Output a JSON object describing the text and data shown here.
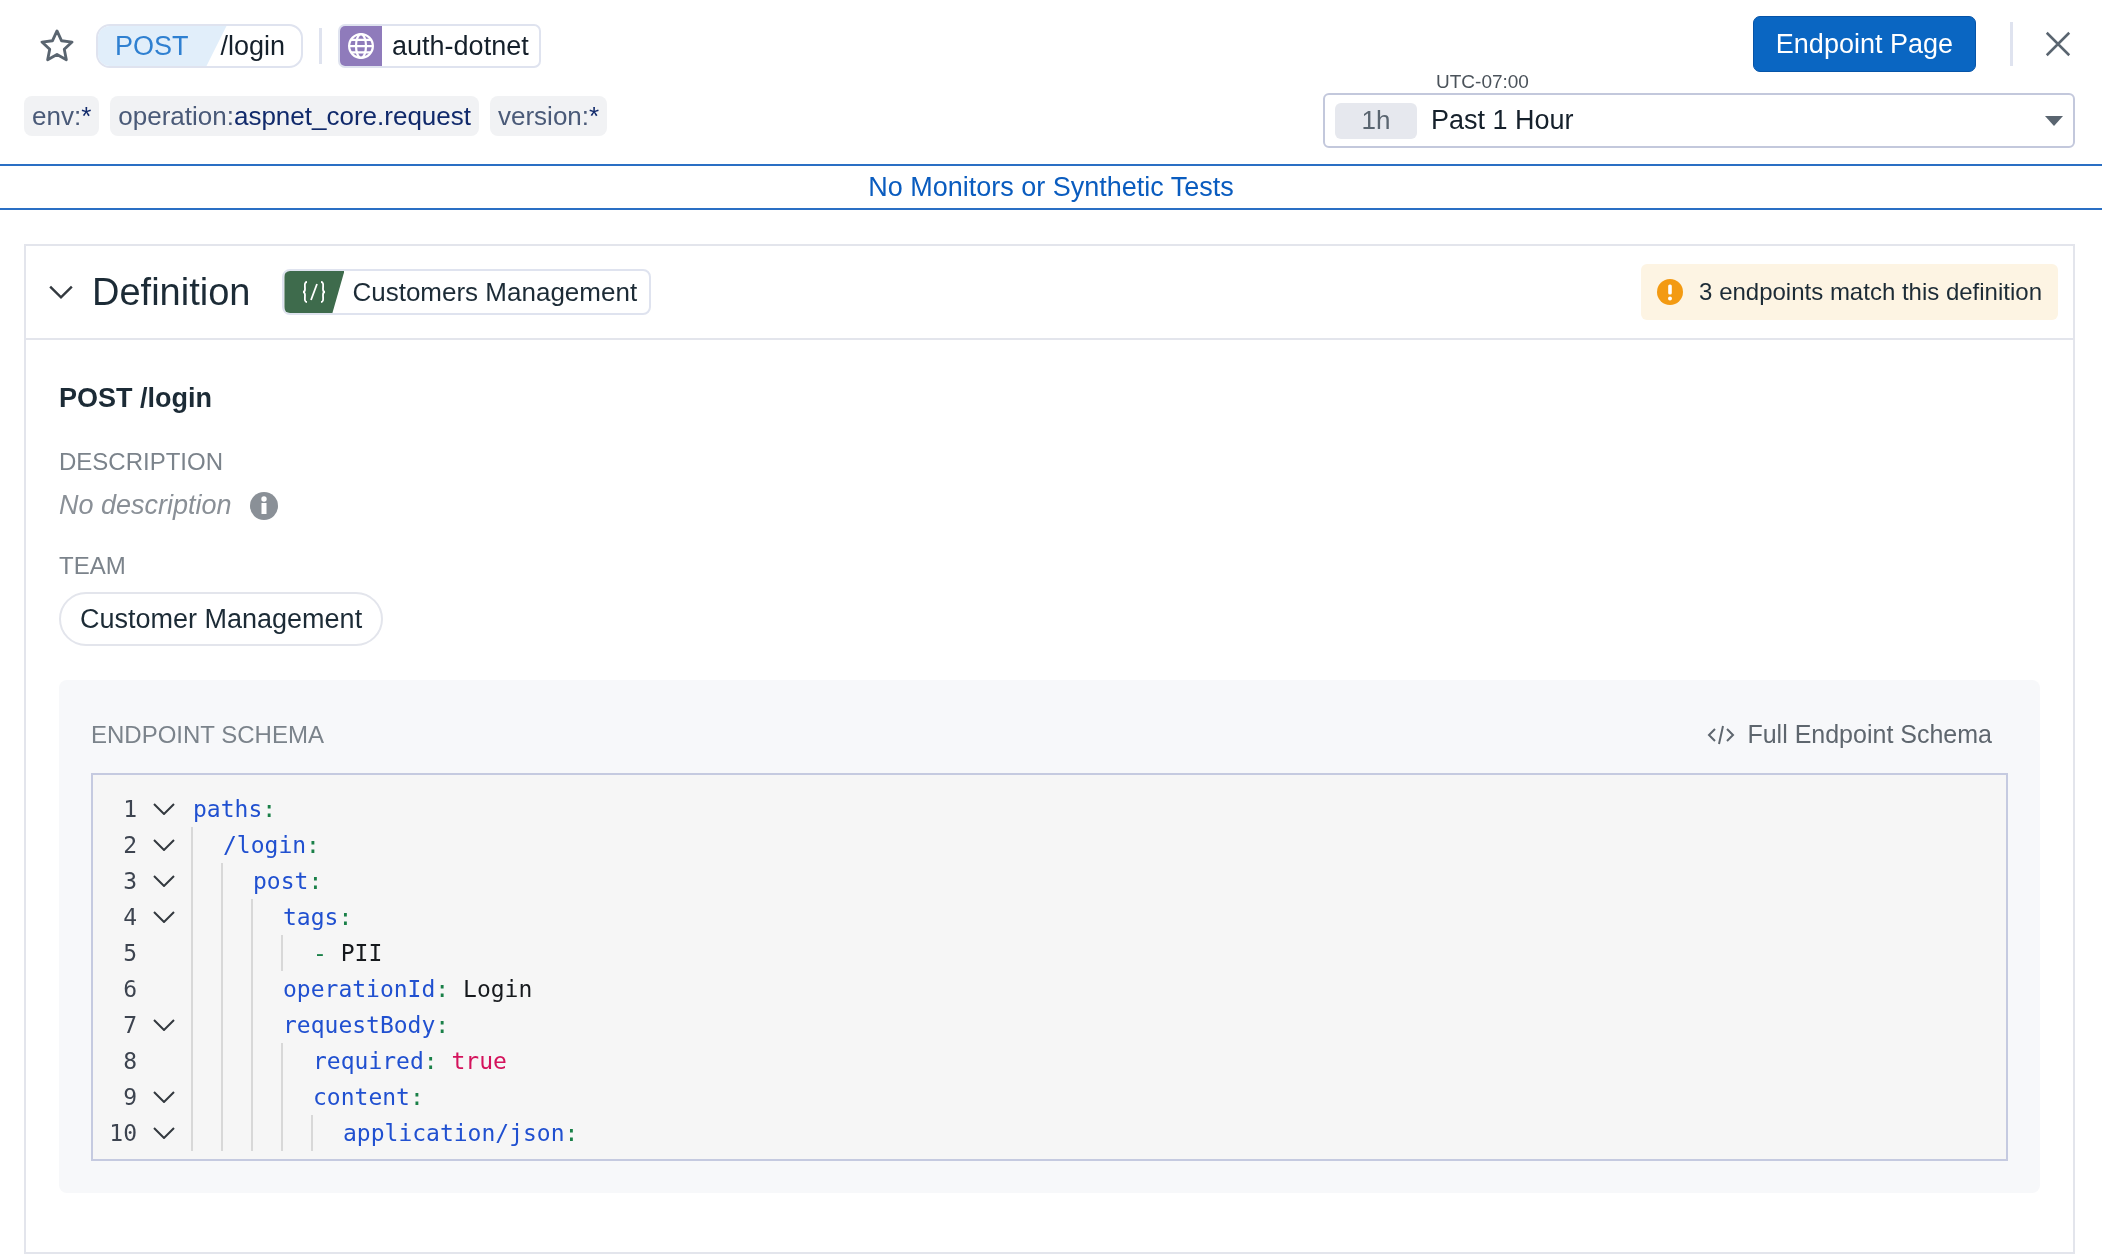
{
  "header": {
    "starred": false,
    "method": "POST",
    "path": "/login",
    "service": "auth-dotnet"
  },
  "filters": [
    {
      "key": "env:",
      "value": "*"
    },
    {
      "key": "operation:",
      "value": "aspnet_core.request"
    },
    {
      "key": "version:",
      "value": "*"
    }
  ],
  "primary_button": "Endpoint Page",
  "time_picker": {
    "timezone": "UTC-07:00",
    "shortcut": "1h",
    "value": "Past 1 Hour"
  },
  "banner": "No Monitors or Synthetic Tests",
  "definition": {
    "expanded": true,
    "title": "Definition",
    "source": "Customers Management",
    "warning": "3 endpoints match this definition",
    "endpoint": "POST /login",
    "description_label": "DESCRIPTION",
    "description": "No description",
    "team_label": "TEAM",
    "team": "Customer Management",
    "schema": {
      "title": "ENDPOINT SCHEMA",
      "link": "Full Endpoint Schema",
      "lines": [
        {
          "number": "1",
          "foldable": true,
          "tokens": [
            {
              "kind": "key",
              "text": "paths"
            },
            {
              "kind": "punct",
              "text": ":"
            }
          ],
          "children": [
            {
              "number": "2",
              "foldable": true,
              "tokens": [
                {
                  "kind": "key",
                  "text": "/login"
                },
                {
                  "kind": "punct",
                  "text": ":"
                }
              ],
              "children": [
                {
                  "number": "3",
                  "foldable": true,
                  "tokens": [
                    {
                      "kind": "key",
                      "text": "post"
                    },
                    {
                      "kind": "punct",
                      "text": ":"
                    }
                  ],
                  "children": [
                    {
                      "number": "4",
                      "foldable": true,
                      "tokens": [
                        {
                          "kind": "key",
                          "text": "tags"
                        },
                        {
                          "kind": "punct",
                          "text": ":"
                        }
                      ],
                      "children": [
                        {
                          "number": "5",
                          "foldable": false,
                          "tokens": [
                            {
                              "kind": "punct",
                              "text": "-"
                            },
                            {
                              "kind": "value",
                              "text": "PII"
                            }
                          ]
                        }
                      ]
                    },
                    {
                      "number": "6",
                      "foldable": false,
                      "tokens": [
                        {
                          "kind": "key",
                          "text": "operationId"
                        },
                        {
                          "kind": "punct",
                          "text": ":"
                        },
                        {
                          "kind": "value",
                          "text": "Login"
                        }
                      ]
                    },
                    {
                      "number": "7",
                      "foldable": true,
                      "tokens": [
                        {
                          "kind": "key",
                          "text": "requestBody"
                        },
                        {
                          "kind": "punct",
                          "text": ":"
                        }
                      ],
                      "children": [
                        {
                          "number": "8",
                          "foldable": false,
                          "tokens": [
                            {
                              "kind": "key",
                              "text": "required"
                            },
                            {
                              "kind": "punct",
                              "text": ":"
                            },
                            {
                              "kind": "bool",
                              "text": "true"
                            }
                          ]
                        },
                        {
                          "number": "9",
                          "foldable": true,
                          "tokens": [
                            {
                              "kind": "key",
                              "text": "content"
                            },
                            {
                              "kind": "punct",
                              "text": ":"
                            }
                          ],
                          "children": [
                            {
                              "number": "10",
                              "foldable": true,
                              "tokens": [
                                {
                                  "kind": "key",
                                  "text": "application/json"
                                },
                                {
                                  "kind": "punct",
                                  "text": ":"
                                }
                              ]
                            }
                          ]
                        }
                      ]
                    }
                  ]
                }
              ]
            }
          ]
        }
      ]
    }
  }
}
